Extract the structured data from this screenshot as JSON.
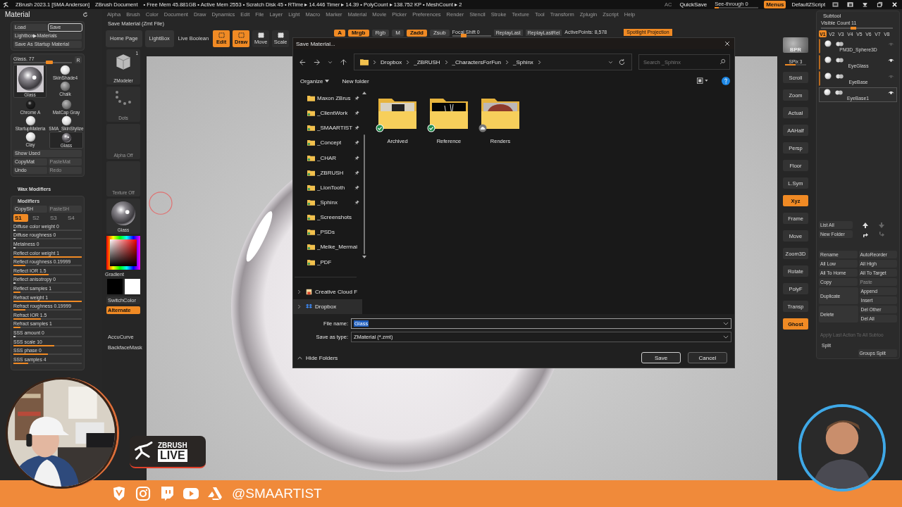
{
  "title_bar": {
    "app": "ZBrush 2023.1 [SMA Anderson]",
    "document": "ZBrush Document",
    "stats": "• Free Mem 45.881GB • Active Mem 2553 • Scratch Disk 45 • RTime ▸ 14.446 Timer ▸ 14.39 • PolyCount ▸ 138.752 KP • MeshCount ▸ 2",
    "ac": "AC",
    "quicksave": "QuickSave",
    "see_through": {
      "label": "See-through  0",
      "level": 0.1
    },
    "menus": {
      "label": "Menus",
      "on": true
    },
    "script": "DefaultZScript"
  },
  "menu_bar": [
    "Alpha",
    "Brush",
    "Color",
    "Document",
    "Draw",
    "Dynamics",
    "Edit",
    "File",
    "Layer",
    "Light",
    "Macro",
    "Marker",
    "Material",
    "Movie",
    "Picker",
    "Preferences",
    "Render",
    "Stencil",
    "Stroke",
    "Texture",
    "Tool",
    "Transform",
    "Zplugin",
    "Zscript",
    "Help"
  ],
  "hint": "Save Material (Zmt File)",
  "toolbar": {
    "buttons": [
      {
        "label": "Home Page",
        "kind": "plain",
        "on": false
      },
      {
        "label": "LightBox",
        "kind": "plain",
        "on": false
      },
      {
        "label": "Live Boolean",
        "kind": "flat",
        "on": false
      },
      {
        "label": "Edit",
        "kind": "mode",
        "on": true
      },
      {
        "label": "Draw",
        "kind": "mode",
        "on": true
      },
      {
        "label": "Move",
        "kind": "mode",
        "on": false
      },
      {
        "label": "Scale",
        "kind": "mode",
        "on": false
      }
    ],
    "brush_modes": [
      {
        "label": "A",
        "on": true
      },
      {
        "label": "Mrgb",
        "on": true
      },
      {
        "label": "Rgb",
        "on": false
      },
      {
        "label": "M",
        "on": false
      },
      {
        "label": "Zadd",
        "on": true
      },
      {
        "label": "Zsub",
        "on": false
      }
    ],
    "focal_shift": {
      "label": "Focal Shift 0",
      "level": 0.3
    },
    "replay": [
      "ReplayLast",
      "ReplayLastRel"
    ],
    "active_points": "ActivePoints: 8,578",
    "spotlight": "Spotlight Projection"
  },
  "material_panel": {
    "title": "Material",
    "file_buttons": [
      {
        "label": "Load",
        "selected": false
      },
      {
        "label": "Save",
        "selected": true
      }
    ],
    "lightbox": "Lightbox▶Materials",
    "startup": "Save As Startup Material",
    "slider": {
      "label": "Glass. 77",
      "level": 0.62
    },
    "reset": "R",
    "current_material": {
      "label": "Glass",
      "kind": "glass"
    },
    "materials": [
      {
        "label": "SkinShade4",
        "kind": "matte",
        "selected": false
      },
      {
        "label": "Chalk",
        "kind": "grey",
        "selected": false
      },
      {
        "label": "Chrome A",
        "kind": "chrome",
        "selected": false
      },
      {
        "label": "MatCap Gray",
        "kind": "grey",
        "selected": false
      },
      {
        "label": "StartupMateria",
        "kind": "matte",
        "selected": false
      },
      {
        "label": "SMA_SkinStylize",
        "kind": "matte",
        "selected": false
      },
      {
        "label": "Clay",
        "kind": "matte",
        "selected": false
      },
      {
        "label": "Glass",
        "kind": "glass",
        "selected": true
      }
    ],
    "actions": [
      [
        {
          "label": "Show Used",
          "disabled": false
        }
      ],
      [
        {
          "label": "CopyMat",
          "disabled": false
        },
        {
          "label": "PasteMat",
          "disabled": true
        }
      ],
      [
        {
          "label": "Undo",
          "disabled": false
        },
        {
          "label": "Redo",
          "disabled": true
        }
      ]
    ]
  },
  "modifiers": {
    "section": "Wax Modifiers",
    "title": "Modifiers",
    "copy": [
      {
        "label": "CopySH",
        "disabled": false
      },
      {
        "label": "PasteSH",
        "disabled": true
      }
    ],
    "slots": [
      {
        "label": "S1",
        "selected": true
      },
      {
        "label": "S2",
        "selected": false
      },
      {
        "label": "S3",
        "selected": false
      },
      {
        "label": "S4",
        "selected": false
      }
    ],
    "sliders": [
      {
        "label": "Diffuse color weight 0",
        "level": 0
      },
      {
        "label": "Diffuse roughness 0",
        "level": 0
      },
      {
        "label": "Metalness 0",
        "level": 0
      },
      {
        "label": "Reflect color weight 1",
        "level": 1
      },
      {
        "label": "Reflect roughness 0.19999",
        "level": 0.18
      },
      {
        "label": "Reflect IOR 1.5",
        "level": 0.52
      },
      {
        "label": "Reflect anisotropy 0",
        "level": 0
      },
      {
        "label": "Reflect samples 1",
        "level": 0.1
      },
      {
        "label": "Refract weight 1",
        "level": 1
      },
      {
        "label": "Refract roughness 0.19999",
        "level": 0.18
      },
      {
        "label": "Refract IOR 1.5",
        "level": 0.4
      },
      {
        "label": "Refract samples 1",
        "level": 0.1
      },
      {
        "label": "SSS amount 0",
        "level": 0
      },
      {
        "label": "SSS scale 10",
        "level": 0.6
      },
      {
        "label": "SSS phase 0",
        "level": 0.5
      },
      {
        "label": "SSS samples 4",
        "level": 0.22
      }
    ]
  },
  "shelf": {
    "tool": {
      "label": "ZModeler",
      "count": "1"
    },
    "stroke": "Dots",
    "alpha": "Alpha Off",
    "texture": "Texture Off",
    "material": "Glass",
    "gradient": "Gradient",
    "switch_color": "SwitchColor",
    "alternate": {
      "label": "Alternate",
      "on": true
    },
    "extras": [
      "AccuCurve",
      "BackfaceMask"
    ]
  },
  "view_tools": [
    {
      "label": "BPR",
      "kind": "render",
      "on": false
    },
    {
      "label": "SPix 3",
      "kind": "slider",
      "on": false,
      "level": 0.5
    },
    {
      "label": "Scroll",
      "kind": "tool",
      "on": false
    },
    {
      "label": "Zoom",
      "kind": "tool",
      "on": false
    },
    {
      "label": "Actual",
      "kind": "tool",
      "on": false
    },
    {
      "label": "AAHalf",
      "kind": "tool",
      "on": false
    },
    {
      "label": "Persp",
      "kind": "tool",
      "on": false
    },
    {
      "label": "Floor",
      "kind": "tool",
      "on": false
    },
    {
      "label": "L.Sym",
      "kind": "tool",
      "on": false
    },
    {
      "label": "Xyz",
      "kind": "tool",
      "on": true
    },
    {
      "label": "Frame",
      "kind": "tool",
      "on": false
    },
    {
      "label": "Move",
      "kind": "tool",
      "on": false
    },
    {
      "label": "Zoom3D",
      "kind": "tool",
      "on": false
    },
    {
      "label": "Rotate",
      "kind": "tool",
      "on": false
    },
    {
      "label": "PolyF",
      "kind": "tool",
      "on": false
    },
    {
      "label": "Transp",
      "kind": "tool",
      "on": false
    },
    {
      "label": "Ghost",
      "kind": "tool",
      "on": true
    }
  ],
  "subtool": {
    "title": "Subtool",
    "visible_count": {
      "label": "Visible Count  11",
      "level": 0.45
    },
    "versions": [
      {
        "label": "V1",
        "selected": true
      },
      {
        "label": "V2",
        "selected": false
      },
      {
        "label": "V3",
        "selected": false
      },
      {
        "label": "V4",
        "selected": false
      },
      {
        "label": "V5",
        "selected": false
      },
      {
        "label": "V6",
        "selected": false
      },
      {
        "label": "V7",
        "selected": false
      },
      {
        "label": "V8",
        "selected": false
      }
    ],
    "items": [
      {
        "name": "PM3D_Sphere3D",
        "visible": false,
        "selected": false
      },
      {
        "name": "EyeGlass",
        "visible": true,
        "selected": false
      },
      {
        "name": "EyeBase",
        "visible": false,
        "selected": false
      },
      {
        "name": "EyeBase1",
        "visible": true,
        "selected": true
      }
    ],
    "list_buttons": [
      "List All",
      "New Folder"
    ],
    "actions": [
      [
        {
          "label": "Rename",
          "disabled": false
        },
        {
          "label": "AutoReorder",
          "disabled": false
        }
      ],
      [
        {
          "label": "All Low",
          "disabled": false
        },
        {
          "label": "All High",
          "disabled": false
        }
      ],
      [
        {
          "label": "All To Home",
          "disabled": false
        },
        {
          "label": "All To Target",
          "disabled": false
        }
      ],
      [
        {
          "label": "Copy",
          "disabled": false
        },
        {
          "label": "Paste",
          "disabled": true
        }
      ]
    ],
    "duplicate": {
      "label": "Duplicate",
      "options": [
        "Append",
        "Insert"
      ]
    },
    "delete": {
      "label": "Delete",
      "options": [
        "Del Other",
        "Del All"
      ]
    },
    "apply_all": "Apply Last Action To All Subtoo",
    "split": "Split",
    "groups_split": "Groups Split"
  },
  "dialog": {
    "title": "Save Material...",
    "path": [
      "Dropbox",
      "_ZBRUSH",
      "_CharactersForFun",
      "_Sphinx"
    ],
    "search": {
      "placeholder": "Search _Sphinx"
    },
    "organize": "Organize",
    "new_folder": "New folder",
    "nav": [
      {
        "label": "Maxon ZBrus",
        "pinned": true,
        "selected": false
      },
      {
        "label": "_ClientWork",
        "pinned": true,
        "selected": false
      },
      {
        "label": "_SMAARTIST",
        "pinned": true,
        "selected": false
      },
      {
        "label": "_Concept",
        "pinned": true,
        "selected": false
      },
      {
        "label": "_CHAR",
        "pinned": true,
        "selected": false
      },
      {
        "label": "_ZBRUSH",
        "pinned": true,
        "selected": false
      },
      {
        "label": "_LionTooth",
        "pinned": true,
        "selected": false
      },
      {
        "label": "_Sphinx",
        "pinned": true,
        "selected": false
      },
      {
        "label": "_Screenshots",
        "pinned": false,
        "selected": false
      },
      {
        "label": "_PSDs",
        "pinned": false,
        "selected": false
      },
      {
        "label": "_Meike_Mermai",
        "pinned": false,
        "selected": false
      },
      {
        "label": "_PDF",
        "pinned": false,
        "selected": false
      }
    ],
    "locations": [
      {
        "label": "Creative Cloud F",
        "kind": "creative",
        "selected": false
      },
      {
        "label": "Dropbox",
        "kind": "dropbox",
        "selected": true
      }
    ],
    "folders": [
      {
        "label": "Archived",
        "kind": "synced"
      },
      {
        "label": "Reference",
        "kind": "synced"
      },
      {
        "label": "Renders",
        "kind": "cloud"
      }
    ],
    "file_name": {
      "label": "File name:",
      "value": "Glass"
    },
    "save_type": {
      "label": "Save as type:",
      "value": "ZMaterial (*.zmt)"
    },
    "hide_folders": "Hide Folders",
    "save": "Save",
    "cancel": "Cancel"
  },
  "live_badge": {
    "brand": "ZBRUSH",
    "label": "LIVE"
  },
  "social_bar": {
    "handle": "@SMAARTIST"
  }
}
